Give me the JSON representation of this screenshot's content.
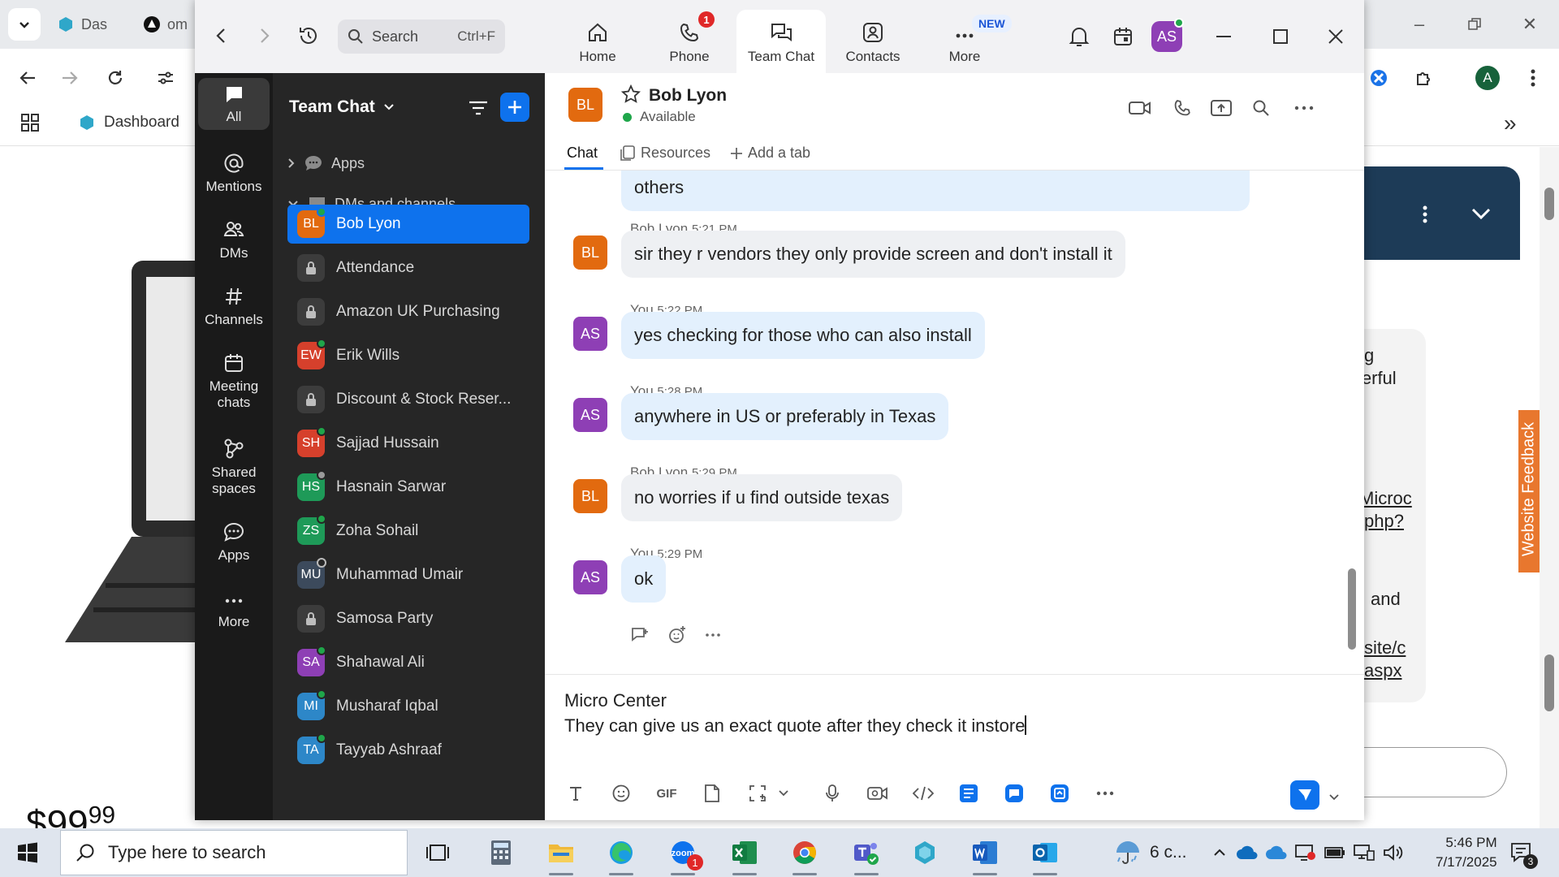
{
  "browser": {
    "tabs": [
      {
        "label": "Das"
      },
      {
        "label": "om"
      }
    ],
    "bookmark": "Dashboard",
    "profile_initial": "A",
    "price": {
      "whole": "$99",
      "cents": "99"
    },
    "chat_widget_lines": [
      "g",
      "lerful",
      "Microc",
      "php?",
      "and",
      "site/c",
      "aspx"
    ],
    "feedback_label": "Website Feedback"
  },
  "zoom": {
    "search": {
      "placeholder": "Search",
      "shortcut": "Ctrl+F"
    },
    "tabs": [
      {
        "label": "Home"
      },
      {
        "label": "Phone",
        "badge": "1"
      },
      {
        "label": "Team Chat"
      },
      {
        "label": "Contacts"
      },
      {
        "label": "More",
        "badge": "NEW"
      }
    ],
    "user_initials": "AS",
    "rail": [
      {
        "label": "All"
      },
      {
        "label": "Mentions"
      },
      {
        "label": "DMs"
      },
      {
        "label": "Channels"
      },
      {
        "label": "Meeting chats"
      },
      {
        "label": "Shared spaces"
      },
      {
        "label": "Apps"
      },
      {
        "label": "More"
      }
    ],
    "sidebar": {
      "title": "Team Chat",
      "sections": {
        "apps": "Apps",
        "dms": "DMs and channels"
      },
      "items": [
        {
          "initials": "BL",
          "name": "Bob Lyon",
          "color": "#e26a0f",
          "status": "online"
        },
        {
          "initials": "",
          "name": "Attendance",
          "color": "",
          "status": "lock"
        },
        {
          "initials": "",
          "name": "Amazon UK Purchasing",
          "color": "",
          "status": "lock"
        },
        {
          "initials": "EW",
          "name": "Erik Wills",
          "color": "#d6402c",
          "status": "online"
        },
        {
          "initials": "",
          "name": "Discount & Stock Reser...",
          "color": "",
          "status": "lock"
        },
        {
          "initials": "SH",
          "name": "Sajjad Hussain",
          "color": "#d6402c",
          "status": "online"
        },
        {
          "initials": "HS",
          "name": "Hasnain Sarwar",
          "color": "#1e9a58",
          "status": "away"
        },
        {
          "initials": "ZS",
          "name": "Zoha Sohail",
          "color": "#1e9a58",
          "status": "online"
        },
        {
          "initials": "MU",
          "name": "Muhammad Umair",
          "color": "#3c4a5c",
          "status": "offline"
        },
        {
          "initials": "",
          "name": "Samosa Party",
          "color": "",
          "status": "lock"
        },
        {
          "initials": "SA",
          "name": "Shahawal Ali",
          "color": "#8e3fb5",
          "status": "online"
        },
        {
          "initials": "MI",
          "name": "Musharaf Iqbal",
          "color": "#2d87c8",
          "status": "online"
        },
        {
          "initials": "TA",
          "name": "Tayyab Ashraaf",
          "color": "#2d87c8",
          "status": "online"
        }
      ]
    },
    "chat": {
      "contact": {
        "initials": "BL",
        "name": "Bob Lyon",
        "status": "Available"
      },
      "tabs": {
        "chat": "Chat",
        "resources": "Resources",
        "add": "Add a tab"
      },
      "partial_message": "others",
      "messages": [
        {
          "sender": "Bob Lyon",
          "initials": "BL",
          "time": "5:21 PM",
          "text": "sir they r vendors they only provide screen and don't install it"
        },
        {
          "sender": "You",
          "initials": "AS",
          "time": "5:22 PM",
          "text": "yes checking for those who can also install"
        },
        {
          "sender": "You",
          "initials": "AS",
          "time": "5:28 PM",
          "text": "anywhere in US or preferably in Texas"
        },
        {
          "sender": "Bob Lyon",
          "initials": "BL",
          "time": "5:29 PM",
          "text": "no worries if u find outside texas"
        },
        {
          "sender": "You",
          "initials": "AS",
          "time": "5:29 PM",
          "text": "ok"
        }
      ],
      "composer": {
        "line1": "Micro Center",
        "line2": "They can give us an exact quote after they check it instore"
      },
      "toolbar": {
        "gif": "GIF"
      }
    }
  },
  "taskbar": {
    "search_placeholder": "Type here to search",
    "weather": "6 c...",
    "time": "5:46 PM",
    "date": "7/17/2025",
    "notification_count": "3",
    "zoom_badge": "1"
  },
  "colors": {
    "zoom_blue": "#0e72ed",
    "rail_bg": "#1a1a1a",
    "sidebar_bg": "#262626",
    "user_avatar": "#8e3fb5",
    "bob_avatar": "#e26a0f"
  }
}
